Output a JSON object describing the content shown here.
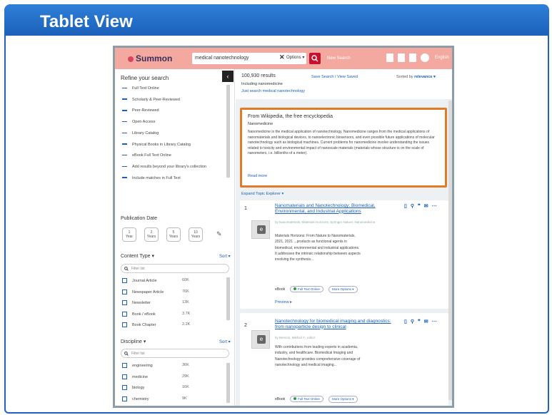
{
  "slide": {
    "title": "Tablet View"
  },
  "app": {
    "logo": "Summon",
    "search_value": "medical nanotechnology",
    "options_label": "Options ▾",
    "new_search": "New Search",
    "language": "English"
  },
  "sidebar": {
    "refine_title": "Refine your search",
    "filters": [
      "Full Text Online",
      "Scholarly & Peer-Reviewed",
      "Peer-Reviewed",
      "Open Access",
      "Library Catalog",
      "Physical Books in Library Catalog",
      "eBook Full Text Online",
      "Add results beyond your library's collection",
      "Include matches in Full Text"
    ],
    "pubdate_title": "Publication Date",
    "years": [
      {
        "n": "1",
        "u": "Year"
      },
      {
        "n": "2",
        "u": "Years"
      },
      {
        "n": "5",
        "u": "Years"
      },
      {
        "n": "10",
        "u": "Years"
      }
    ],
    "content_type_title": "Content Type ▾",
    "sort_label": "Sort ▾",
    "filter_placeholder": "Filter list",
    "content_types": [
      {
        "label": "Journal Article",
        "count": "60K"
      },
      {
        "label": "Newspaper Article",
        "count": "76K"
      },
      {
        "label": "Newsletter",
        "count": "13K"
      },
      {
        "label": "Book / eBook",
        "count": "3.7K"
      },
      {
        "label": "Book Chapter",
        "count": "2.2K"
      }
    ],
    "discipline_title": "Discipline ▾",
    "disciplines": [
      {
        "label": "engineering",
        "count": "36K"
      },
      {
        "label": "medicine",
        "count": "29K"
      },
      {
        "label": "biology",
        "count": "16K"
      },
      {
        "label": "chemistry",
        "count": "9K"
      },
      {
        "label": "sciences",
        "count": "5.7K"
      }
    ]
  },
  "main": {
    "results": "100,930 results",
    "save_search": "Save Search / View Saved",
    "sort_by": "Sorted by",
    "sort_value": "relevance ▾",
    "including": "Including nanomedicine",
    "just_search": "Just search medical nanotechnology",
    "wiki_source": "From Wikipedia, the free encyclopedia",
    "wiki_term": "Nanomedicine",
    "wiki_body": "Nanomedicine is the medical application of nanotechnology. Nanomedicine ranges from the medical applications of nanomaterials and biological devices, to nanoelectronic biosensors, and even possible future applications of molecular nanotechnology such as biological machines. Current problems for nanomedicine involve understanding the issues related to toxicity and environmental impact of nanoscale materials (materials whose structure is on the scale of nanometers, i.e. billionths of a meter).",
    "read_more": "Read more",
    "explorer": "Expand Topic Explorer ▾",
    "results_list": [
      {
        "num": "1",
        "title": "Nanomaterials and Nanotechnology: Biomedical, Environmental, and Industrial Applications",
        "meta": "by Nanomaterials; Materials Horizons; Springer Nature; Nanomedicine",
        "text": "Materials Horizons: From Nature to Nanomaterials, 2021, 2021 ...products as functional agents in biomedical, environmental and industrial applications. It addresses the intrinsic relationship between aspects involving the synthesis...",
        "type": "eBook",
        "fulltext": "Full Text Online",
        "more": "More Options ▾",
        "preview": "Preview ▸"
      },
      {
        "num": "2",
        "title": "Nanotechnology for biomedical imaging and diagnostics: from nanoparticle design to clinical",
        "meta": "by Berezin, Mikhail Y., editor",
        "text": "With contributions from leading experts in academia, industry, and healthcare. Biomedical Imaging and Nanotechnology provides comprehensive coverage of nanotechnology and medical imaging...",
        "type": "eBook",
        "fulltext": "Full Text Online",
        "more": "More Options ▾"
      }
    ]
  },
  "colors": {
    "header_blue": "#2f7fd9",
    "appbar": "#f4a9a0",
    "highlight": "#e07b28",
    "link": "#1a5fb8"
  }
}
